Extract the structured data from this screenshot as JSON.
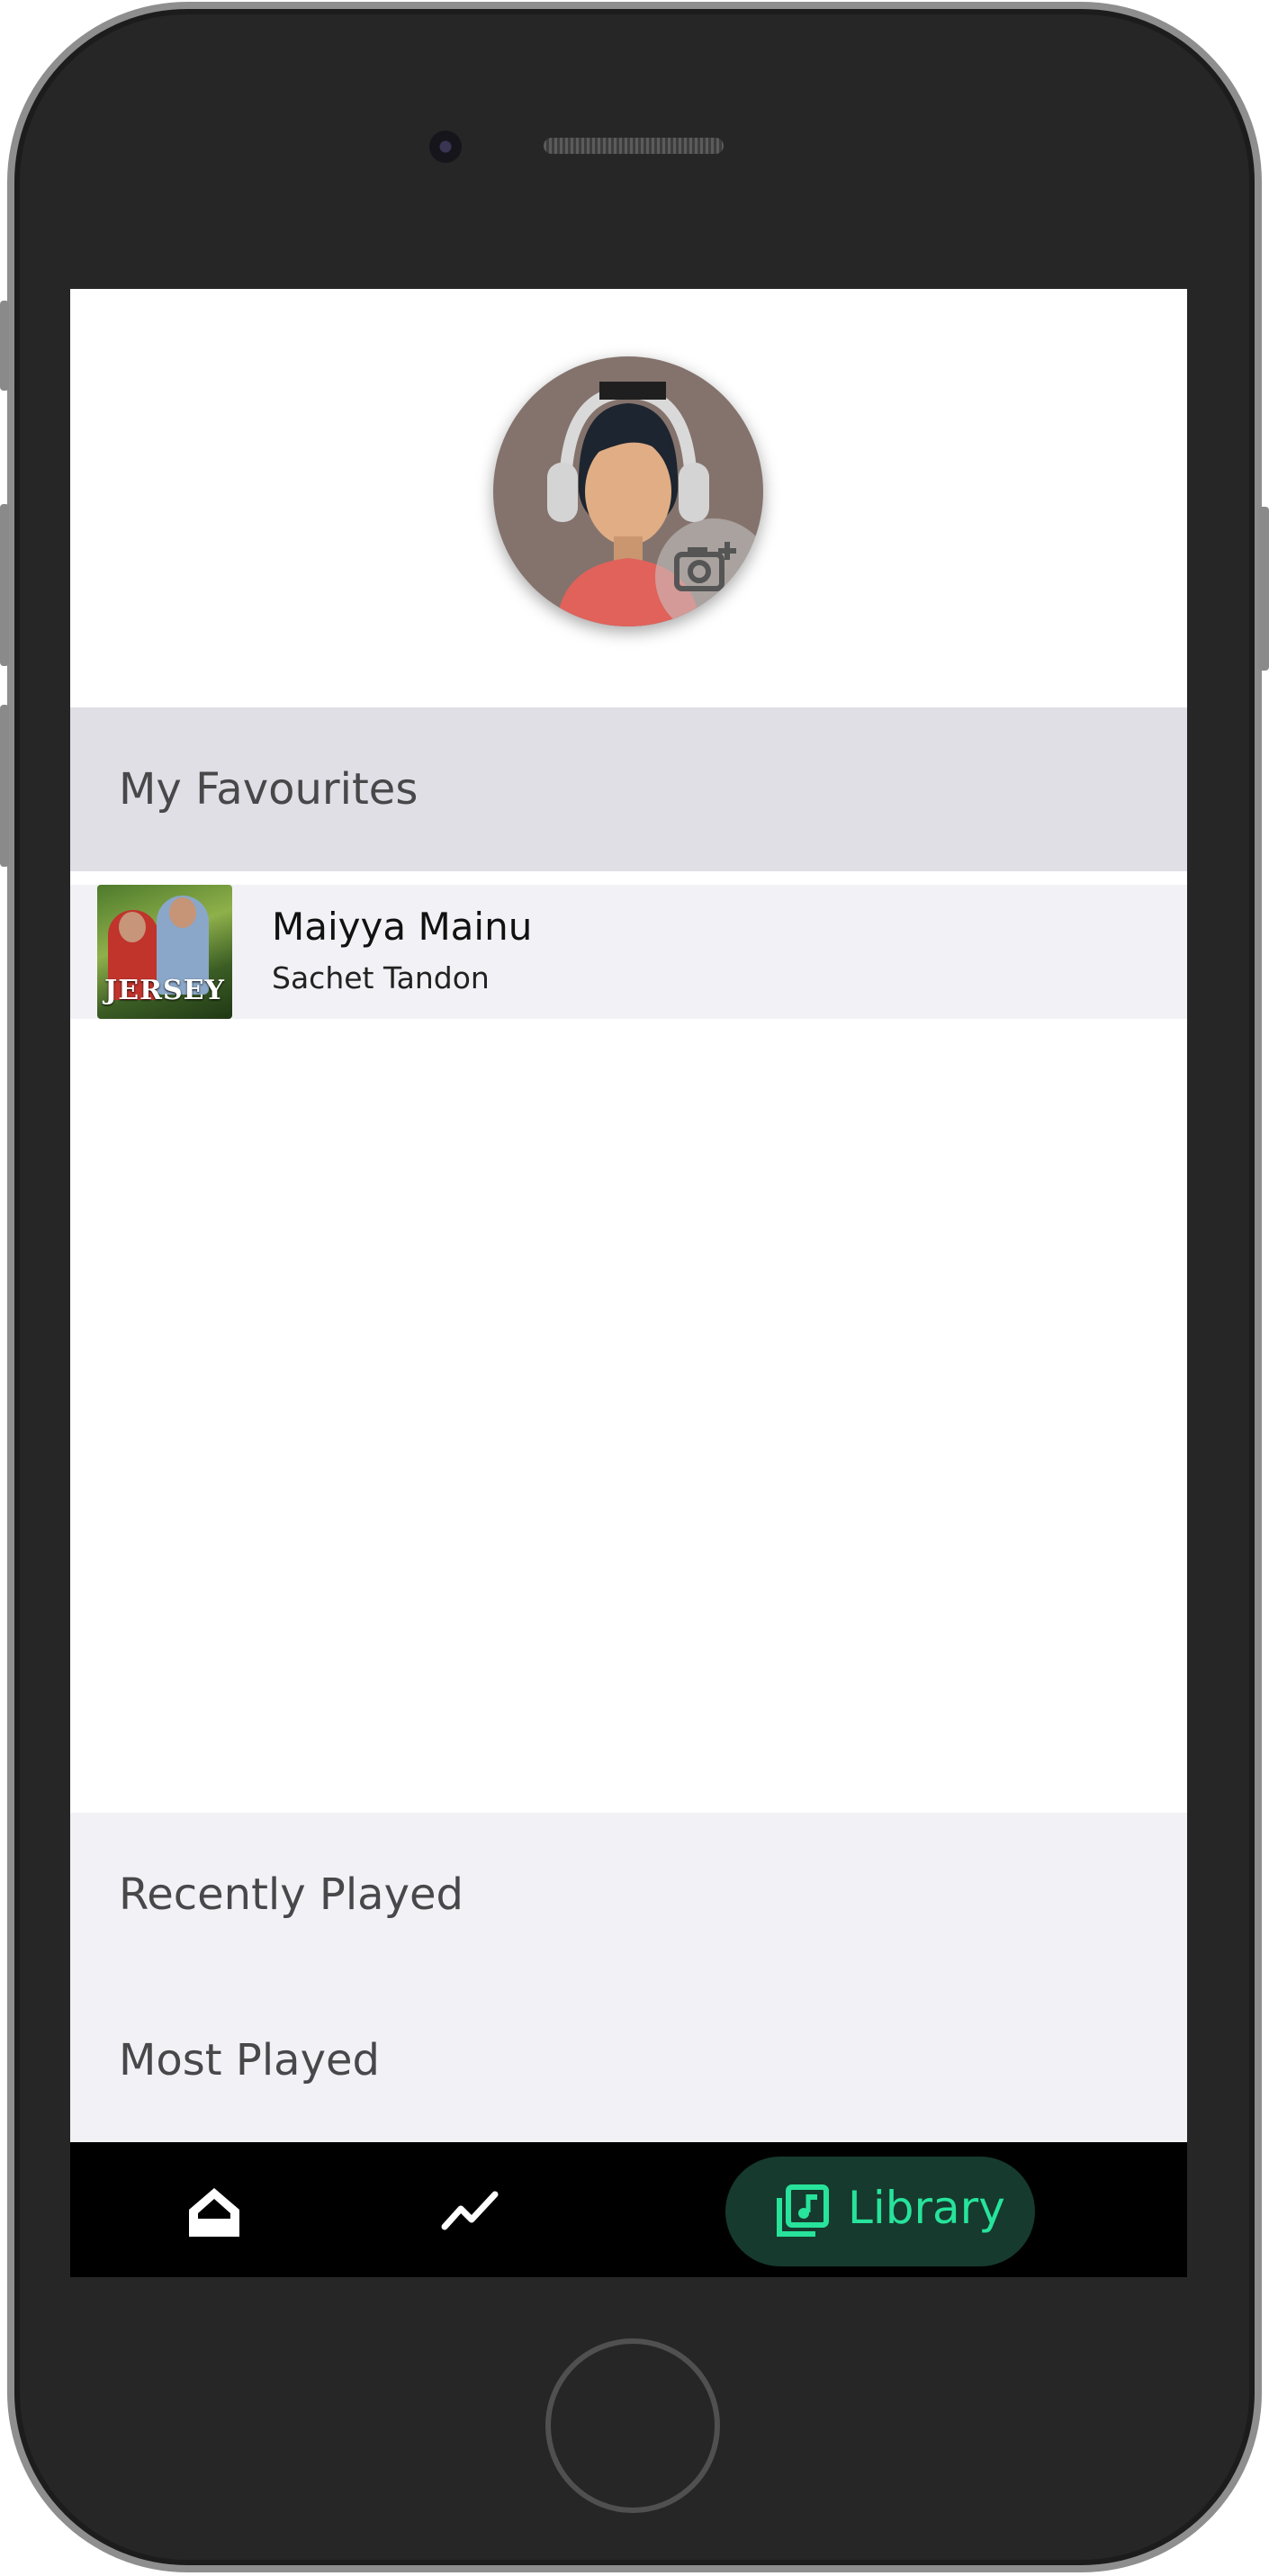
{
  "favourites": {
    "header": "My Favourites",
    "songs": [
      {
        "title": "Maiyya Mainu",
        "artist": "Sachet Tandon",
        "album_art_text": "JERSEY"
      }
    ]
  },
  "sections": {
    "recently_played": "Recently Played",
    "most_played": "Most Played"
  },
  "nav": {
    "items": [
      {
        "icon": "home-icon"
      },
      {
        "icon": "trending-icon"
      },
      {
        "icon": "library-music-icon",
        "label": "Library",
        "active": true
      }
    ]
  },
  "colors": {
    "accent": "#27e39b",
    "active_pill": "#163a2e",
    "nav_background": "#000000",
    "favourites_header_bg": "#dfdfe5",
    "list_bg": "#f2f2f6"
  }
}
